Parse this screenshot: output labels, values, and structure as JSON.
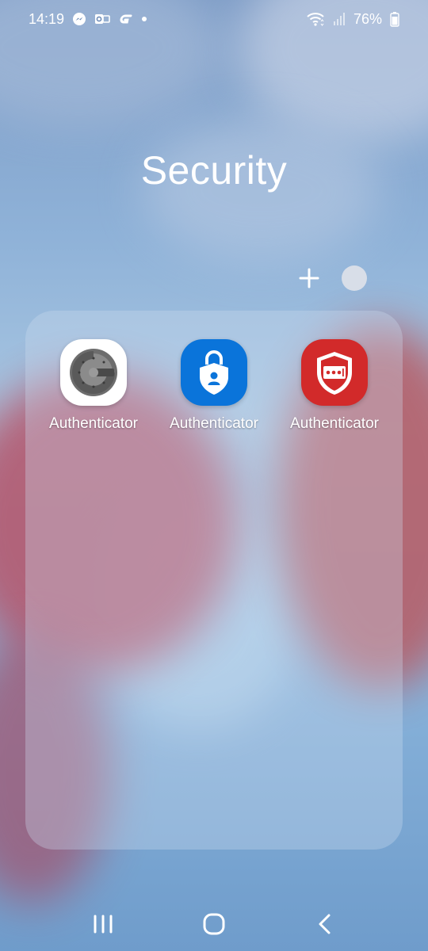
{
  "status_bar": {
    "time": "14:19",
    "notification_icons": [
      "messenger-icon",
      "outlook-icon",
      "g-app-icon",
      "more-dot-icon"
    ],
    "battery": "76%",
    "system_icons": [
      "wifi-icon",
      "signal-icon",
      "battery-icon"
    ]
  },
  "folder": {
    "title": "Security",
    "apps": [
      {
        "label": "Authenticator",
        "icon": "google-authenticator-icon",
        "color": "#ffffff"
      },
      {
        "label": "Authenticator",
        "icon": "microsoft-authenticator-icon",
        "color": "#0a74da"
      },
      {
        "label": "Authenticator",
        "icon": "lastpass-authenticator-icon",
        "color": "#d22a2a"
      }
    ]
  },
  "navigation": {
    "buttons": [
      "recents-icon",
      "home-icon",
      "back-icon"
    ]
  },
  "colors": {
    "folder_color_swatch": "#d8dee8",
    "text": "#ffffff"
  }
}
